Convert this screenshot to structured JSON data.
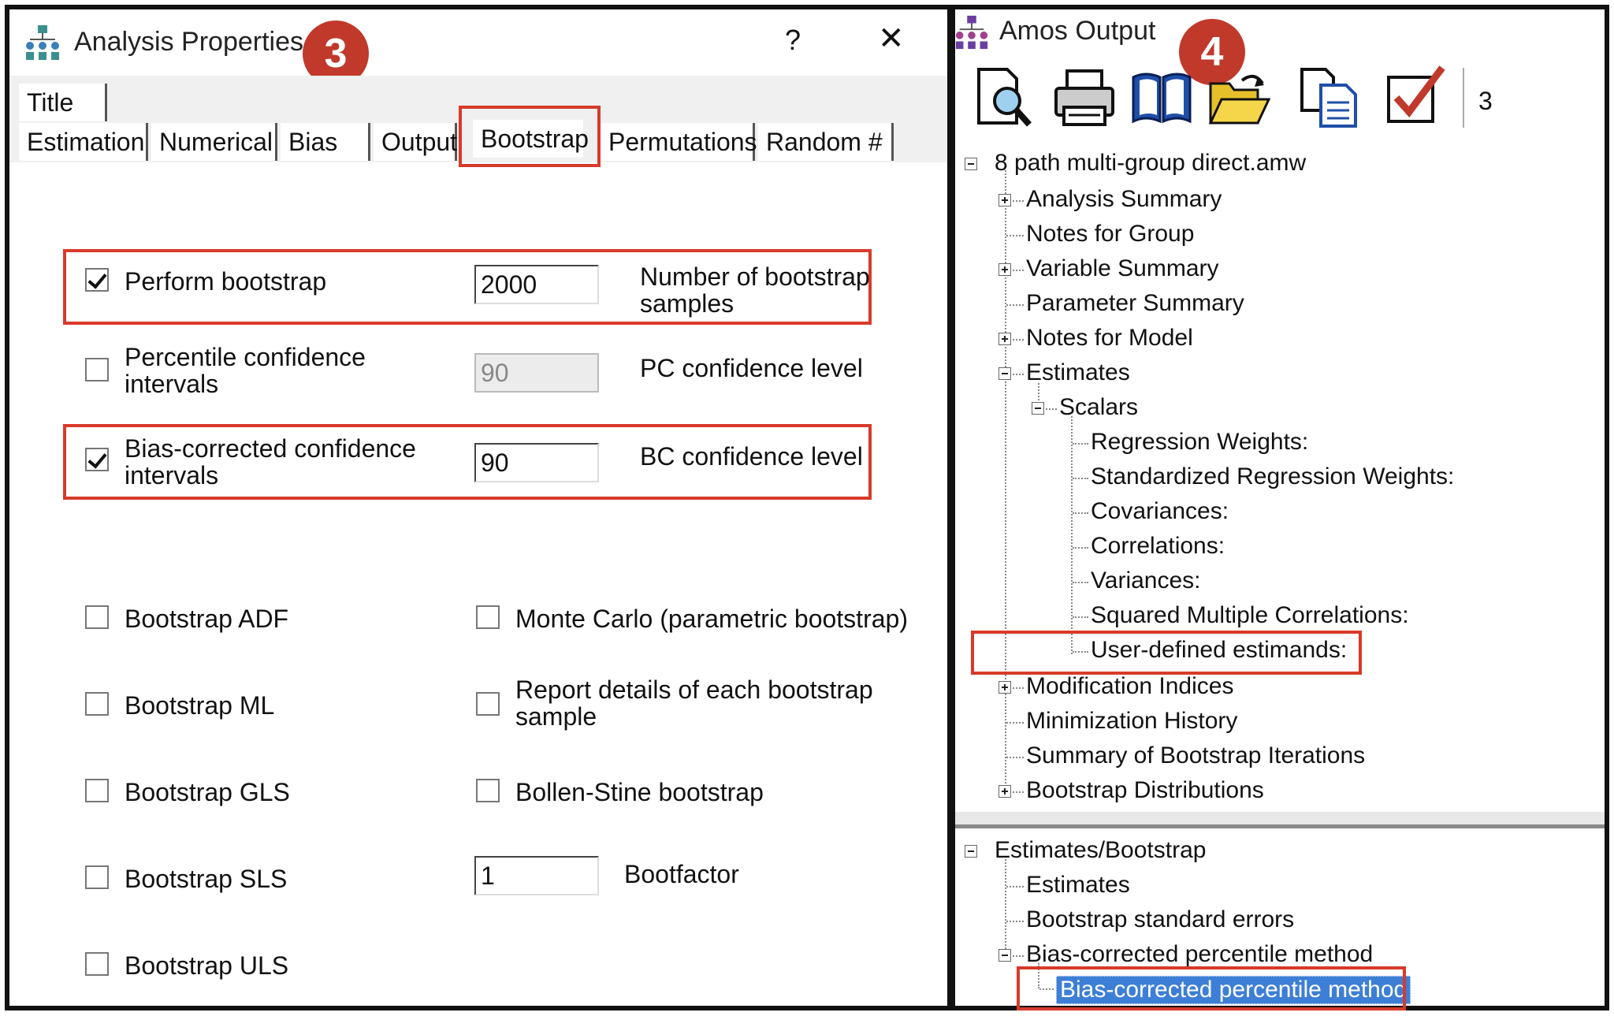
{
  "left": {
    "title": "Analysis Properties",
    "help": "?",
    "close": "✕",
    "badge": "3",
    "tabs_row1": [
      "Title"
    ],
    "tabs_row2": [
      "Estimation",
      "Numerical",
      "Bias",
      "Output",
      "Bootstrap",
      "Permutations",
      "Random #"
    ],
    "perform_bootstrap": {
      "label": "Perform bootstrap",
      "checked": true,
      "value": "2000",
      "desc1": "Number of bootstrap",
      "desc2": "samples"
    },
    "percentile_ci": {
      "label1": "Percentile confidence",
      "label2": "intervals",
      "checked": false,
      "value": "90",
      "desc": "PC confidence level"
    },
    "bias_ci": {
      "label1": "Bias-corrected confidence",
      "label2": "intervals",
      "checked": true,
      "value": "90",
      "desc": "BC confidence level"
    },
    "options_left": [
      "Bootstrap ADF",
      "Bootstrap ML",
      "Bootstrap GLS",
      "Bootstrap SLS",
      "Bootstrap ULS"
    ],
    "monte_carlo": "Monte Carlo (parametric bootstrap)",
    "report_details1": "Report details of each bootstrap",
    "report_details2": "sample",
    "bollen_stine": "Bollen-Stine bootstrap",
    "bootfactor": {
      "value": "1",
      "label": "Bootfactor"
    }
  },
  "right": {
    "title": "Amos Output",
    "badge": "4",
    "toolbar_count": "3",
    "toolbar_icons": [
      "print-preview-icon",
      "print-icon",
      "book-icon",
      "open-folder-icon",
      "copy-icon",
      "checkbox-icon"
    ],
    "tree_top": {
      "root": "8 path multi-group direct.amw",
      "items": [
        "Analysis Summary",
        "Notes for Group",
        "Variable Summary",
        "Parameter Summary",
        "Notes for Model",
        "Estimates"
      ],
      "scalars": "Scalars",
      "scalar_items": [
        "Regression Weights:",
        "Standardized Regression Weights:",
        "Covariances:",
        "Correlations:",
        "Variances:",
        "Squared Multiple Correlations:",
        "User-defined estimands:"
      ],
      "after_items": [
        "Modification Indices",
        "Minimization History",
        "Summary of Bootstrap Iterations",
        "Bootstrap Distributions"
      ]
    },
    "tree_bottom": {
      "root": "Estimates/Bootstrap",
      "items": [
        "Estimates",
        "Bootstrap standard errors",
        "Bias-corrected percentile method"
      ],
      "selected": "Bias-corrected percentile method"
    }
  },
  "colors": {
    "highlight": "#d73a2a",
    "badge": "#c0392b",
    "selection": "#3d7fd6"
  }
}
